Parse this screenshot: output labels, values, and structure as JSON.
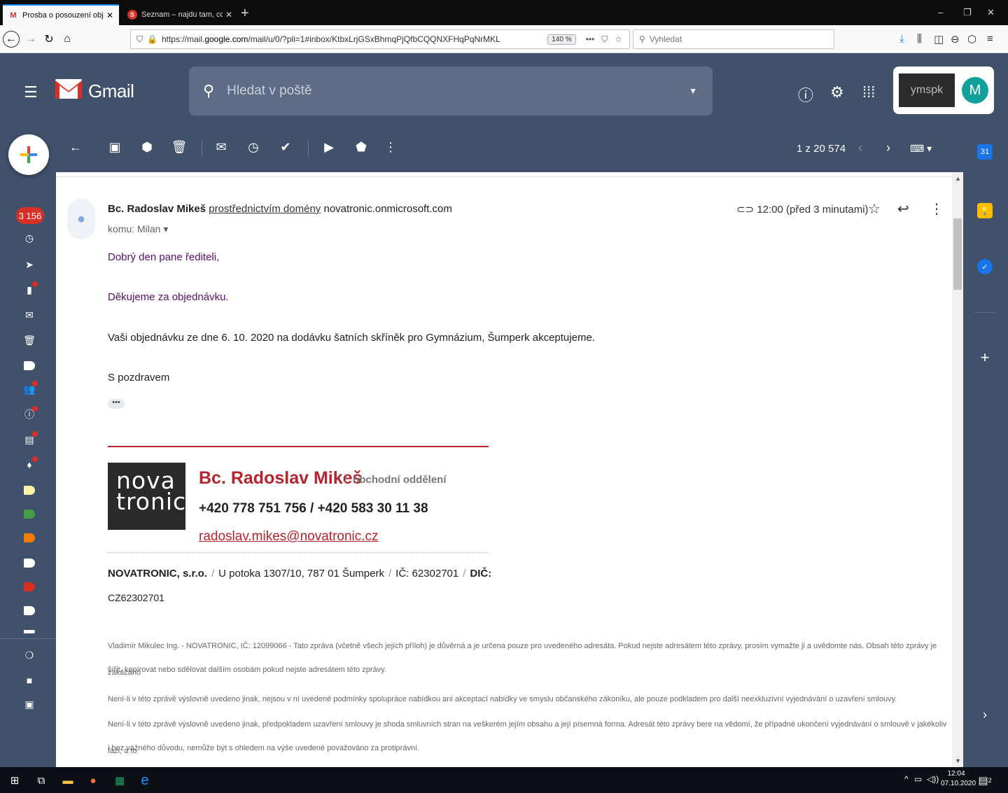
{
  "browser": {
    "tabs": [
      {
        "title": "Prosba o posouzení objednávky",
        "favicon": "M",
        "active": true
      },
      {
        "title": "Seznam – najdu tam, co neznám",
        "favicon": "S",
        "active": false
      }
    ],
    "url_prefix": "https://mail.",
    "url_domain": "google.com",
    "url_suffix": "/mail/u/0/?pli=1#inbox/KtbxLrjGSxBhmqPjQfbCQQNXFHqPqNrMKL",
    "zoom": "140 %",
    "search_placeholder": "Vyhledat"
  },
  "gmail": {
    "app_name": "Gmail",
    "search_placeholder": "Hledat v poště",
    "account_initial": "M",
    "account_logo_text": "ymspk",
    "unread_count": "3 156",
    "pager": "1 z 20 574"
  },
  "message": {
    "sender_name": "Bc. Radoslav Mikeš",
    "via_text": "prostřednictvím domény",
    "via_domain": "novatronic.onmicrosoft.com",
    "recipient": "komu: Milan",
    "time": "12:00 (před 3 minutami)",
    "greeting": "Dobrý den pane řediteli,",
    "thanks": "Děkujeme za objednávku.",
    "body": "Vaši objednávku ze dne 6. 10. 2020 na dodávku šatních skříněk pro Gymnázium, Šumperk akceptujeme.",
    "closing": "S pozdravem",
    "ellipsis": "•••"
  },
  "signature": {
    "logo_line1": "nova",
    "logo_line2": "tronic",
    "name": "Bc. Radoslav Mikeš",
    "slash": "/",
    "department": "obchodní oddělení",
    "phones": "+420 778 751 756   /   +420 583 30 11 38",
    "email": "radoslav.mikes@novatronic.cz",
    "company": "NOVATRONIC, s.r.o.",
    "address": "U potoka 1307/10, 787 01 Šumperk",
    "ico": "IČ: 62302701",
    "dic_label": "DIČ:",
    "dic_value": "CZ62302701"
  },
  "disclaimers": [
    "Vladimír Mikulec Ing. - NOVATRONIC, IČ: 12099066 - Tato zpráva (včetně všech jejích příloh) je důvěrná a je určena pouze pro uvedeného adresáta. Pokud nejste adresátem této zprávy, prosím vymažte ji a uvědomte nás. Obsah této zprávy je zakázáno",
    "šířit, kopírovat nebo sdělovat dalším osobám pokud nejste adresátem této zprávy.",
    "Není-li v této zprávě výslovně uvedeno jinak, nejsou v ní uvedené podmínky spolupráce nabídkou ani akceptací nabídky ve smyslu občanského zákoníku, ale pouze podkladem pro další neexkluzivní vyjednávání o uzavření smlouvy.",
    "Není-li v této zprávě výslovně uvedeno jinak, předpokladem uzavření smlouvy je shoda smluvních stran na veškerém jejím obsahu a její písemná forma. Adresát této zprávy bere na vědomí, že případné ukončení vyjednávání o smlouvě v jakékoliv fázi, a to",
    "i bez vážného důvodu, nemůže být s ohledem na výše uvedené považováno za protiprávní."
  ],
  "taskbar": {
    "time": "12:04",
    "date": "07.10.2020",
    "notifications": "2"
  },
  "colors": {
    "gmail_header": "#41506b",
    "signature_red": "#b7232d",
    "body_purple": "#5b0f6e",
    "badge_red": "#d93025"
  }
}
